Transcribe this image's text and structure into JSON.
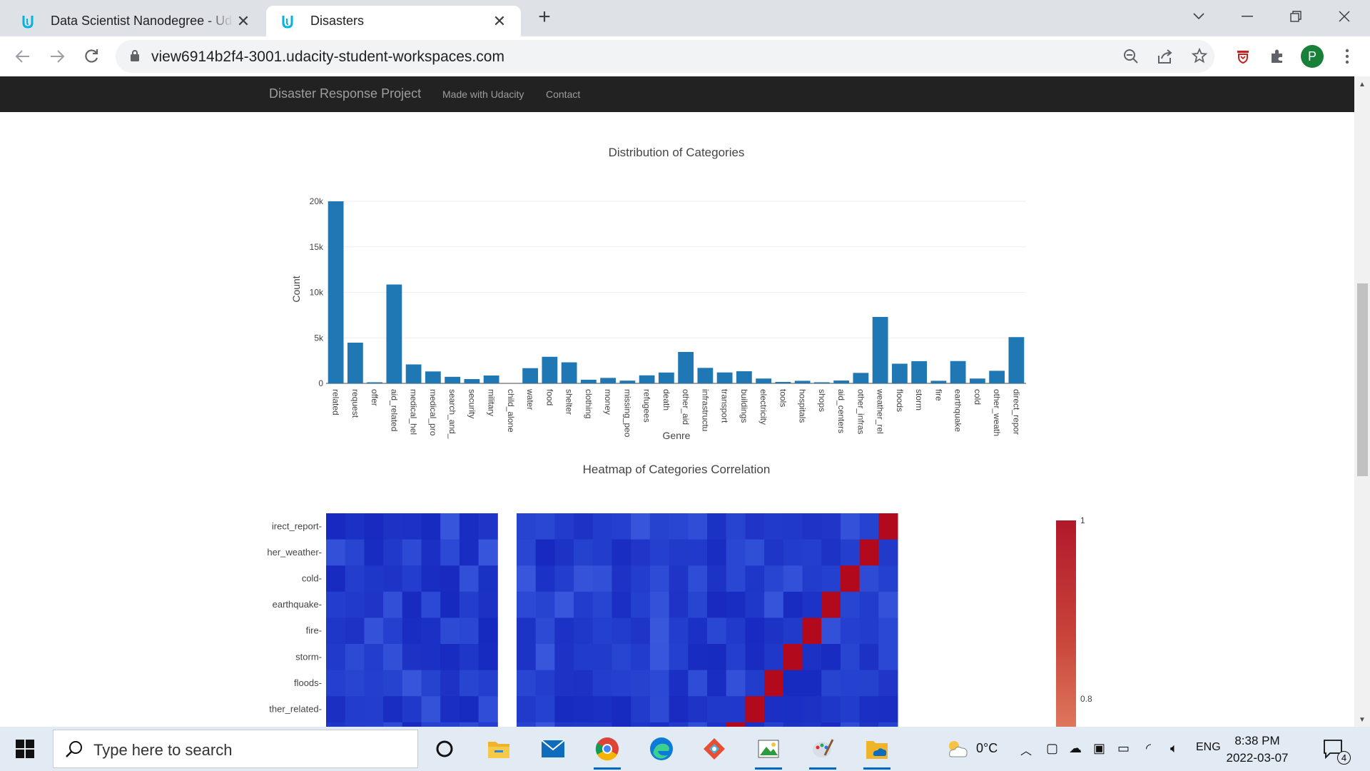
{
  "browser": {
    "tabs": [
      {
        "title": "Data Scientist Nanodegree - Udacity",
        "active": false,
        "close": "✕"
      },
      {
        "title": "Disasters",
        "active": true,
        "close": "✕"
      }
    ],
    "new_tab": "+",
    "url": "view6914b2f4-3001.udacity-student-workspaces.com",
    "profile_initial": "P",
    "colors": {
      "tab_bar": "#dee1e6",
      "udacity_blue": "#02b3e4",
      "profile": "#188038"
    }
  },
  "page": {
    "navbar": {
      "brand": "Disaster Response Project",
      "links": [
        "Made with Udacity",
        "Contact"
      ]
    }
  },
  "chart_data": [
    {
      "type": "bar",
      "title": "Distribution of Categories",
      "xlabel": "Genre",
      "ylabel": "Count",
      "ylim": [
        0,
        20000
      ],
      "yticks": [
        "0",
        "5k",
        "10k",
        "15k",
        "20k"
      ],
      "yticks_values": [
        0,
        5000,
        10000,
        15000,
        20000
      ],
      "grid": true,
      "color": "#1f77b4",
      "categories": [
        "related",
        "request",
        "offer",
        "aid_related",
        "medical_hel",
        "medical_pro",
        "search_and_",
        "security",
        "military",
        "child_alone",
        "water",
        "food",
        "shelter",
        "clothing",
        "money",
        "missing_peo",
        "refugees",
        "death",
        "other_aid",
        "infrastructu",
        "transport",
        "buildings",
        "electricity",
        "tools",
        "hospitals",
        "shops",
        "aid_centers",
        "other_infras",
        "weather_rel",
        "floods",
        "storm",
        "fire",
        "earthquake",
        "cold",
        "other_weath",
        "direct_repor"
      ],
      "values": [
        20000,
        4470,
        120,
        10860,
        2080,
        1310,
        720,
        470,
        860,
        0,
        1670,
        2920,
        2310,
        400,
        600,
        300,
        880,
        1190,
        3450,
        1700,
        1200,
        1330,
        530,
        160,
        280,
        120,
        310,
        1150,
        7300,
        2160,
        2440,
        280,
        2450,
        530,
        1380,
        5080
      ]
    },
    {
      "type": "heatmap",
      "title": "Heatmap of Categories Correlation",
      "colorscale": "RdBu (reversed)",
      "colorbar_ticks": [
        "1",
        "0.8"
      ],
      "y_visible": [
        "irect_report",
        "her_weather",
        "cold",
        "earthquake",
        "fire",
        "storm",
        "floods",
        "ther_related"
      ]
    }
  ],
  "taskbar": {
    "search_placeholder": "Type here to search",
    "weather": "0°C",
    "language": "ENG",
    "time": "8:38 PM",
    "date": "2022-03-07",
    "notifications": "4"
  }
}
